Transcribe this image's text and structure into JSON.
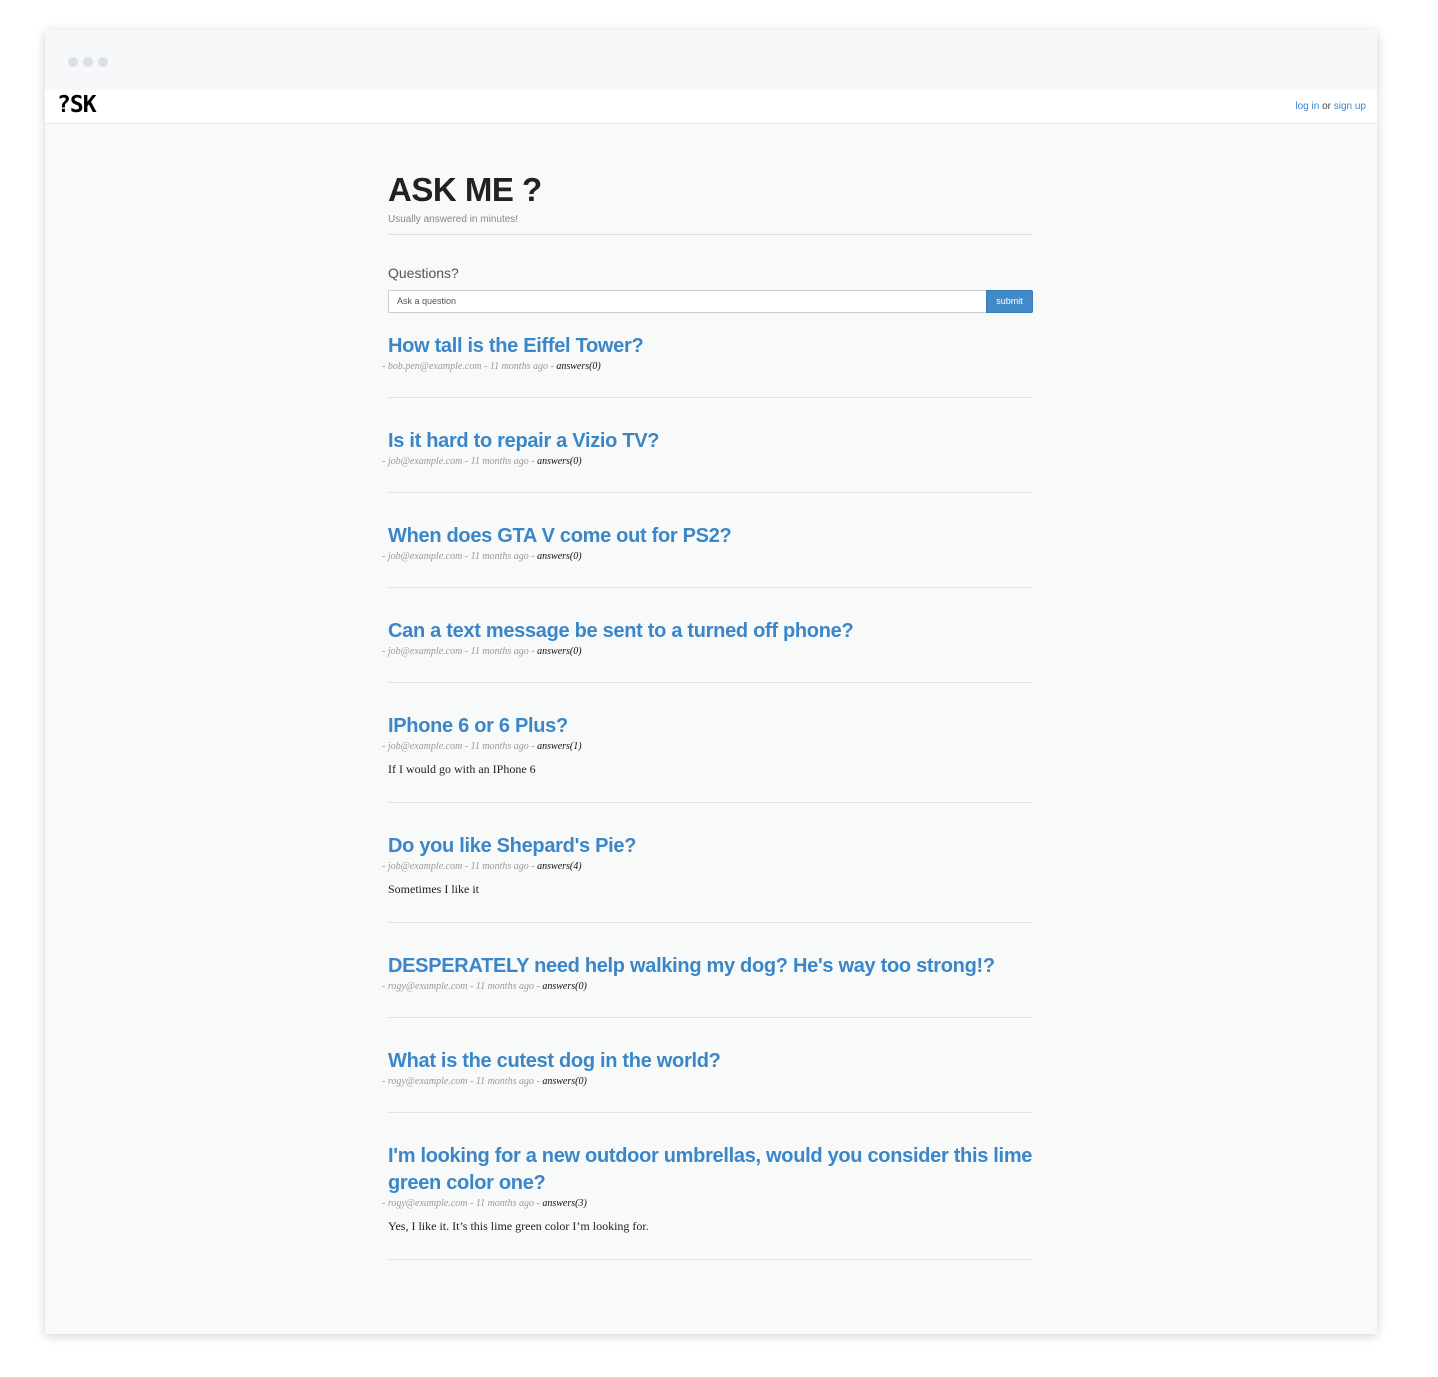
{
  "navbar": {
    "logo": "?SK",
    "login_label": "log in",
    "or_label": "or",
    "signup_label": "sign up"
  },
  "header": {
    "title": "ASK ME ?",
    "tagline": "Usually answered in minutes!"
  },
  "ask": {
    "section_label": "Questions?",
    "placeholder": "Ask a question",
    "submit_label": "submit"
  },
  "questions": [
    {
      "title": "How tall is the Eiffel Tower?",
      "author": "bob.pen@example.com",
      "time": "11 months ago",
      "answers_label": "answers(0)",
      "answer": ""
    },
    {
      "title": "Is it hard to repair a Vizio TV?",
      "author": "job@example.com",
      "time": "11 months ago",
      "answers_label": "answers(0)",
      "answer": ""
    },
    {
      "title": "When does GTA V come out for PS2?",
      "author": "job@example.com",
      "time": "11 months ago",
      "answers_label": "answers(0)",
      "answer": ""
    },
    {
      "title": "Can a text message be sent to a turned off phone?",
      "author": "job@example.com",
      "time": "11 months ago",
      "answers_label": "answers(0)",
      "answer": ""
    },
    {
      "title": "IPhone 6 or 6 Plus?",
      "author": "job@example.com",
      "time": "11 months ago",
      "answers_label": "answers(1)",
      "answer": "If I would go with an IPhone 6"
    },
    {
      "title": "Do you like Shepard's Pie?",
      "author": "job@example.com",
      "time": "11 months ago",
      "answers_label": "answers(4)",
      "answer": "Sometimes I like it"
    },
    {
      "title": "DESPERATELY need help walking my dog? He's way too strong!?",
      "author": "rogy@example.com",
      "time": "11 months ago",
      "answers_label": "answers(0)",
      "answer": ""
    },
    {
      "title": "What is the cutest dog in the world?",
      "author": "rogy@example.com",
      "time": "11 months ago",
      "answers_label": "answers(0)",
      "answer": ""
    },
    {
      "title": "I'm looking for a new outdoor umbrellas, would you consider this lime green color one?",
      "author": "rogy@example.com",
      "time": "11 months ago",
      "answers_label": "answers(3)",
      "answer": "Yes, I like it. It’s this lime green color I’m looking for."
    }
  ]
}
